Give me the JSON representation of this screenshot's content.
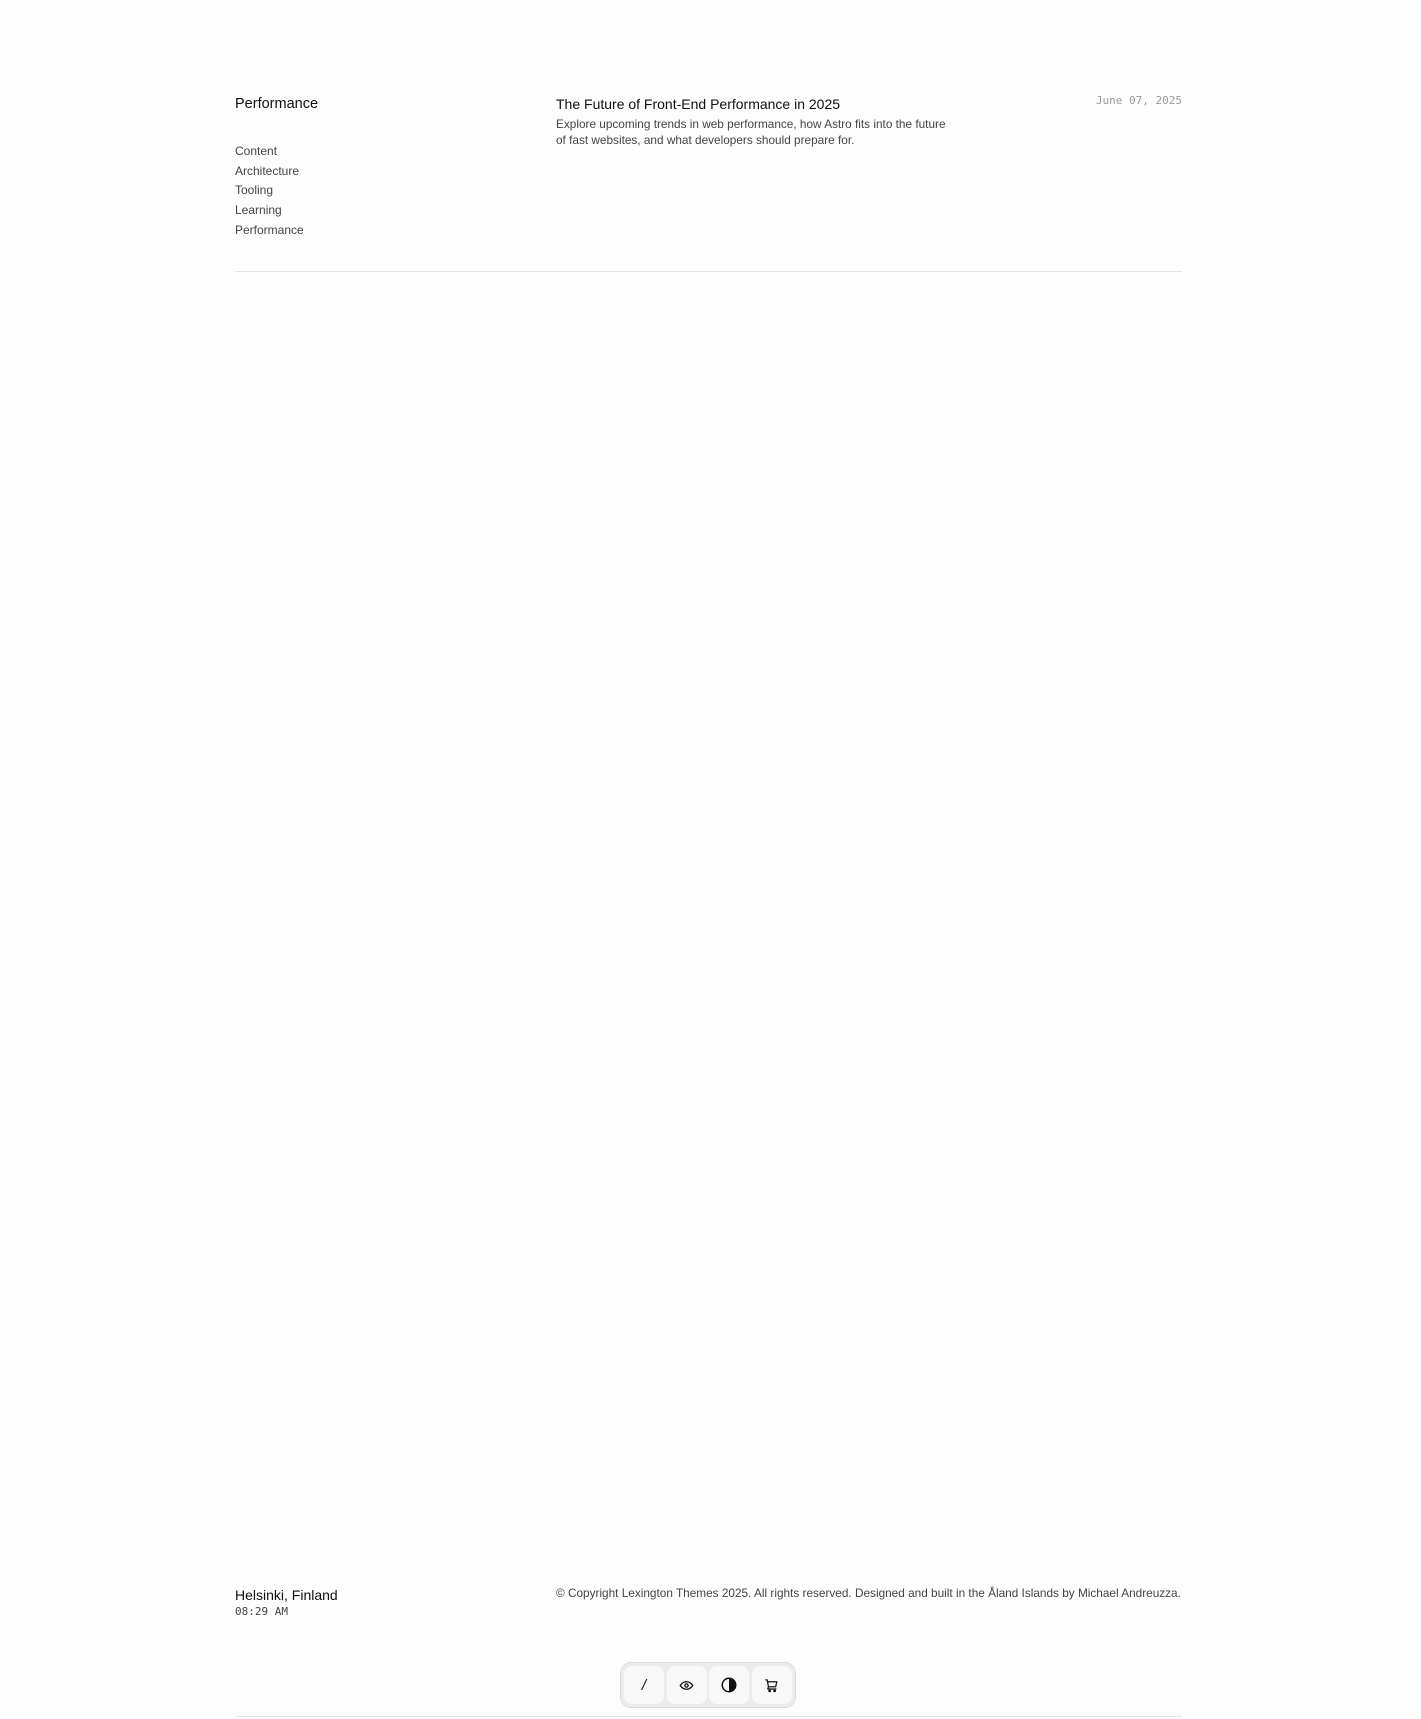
{
  "category": {
    "title": "Performance",
    "topics": [
      "Content",
      "Architecture",
      "Tooling",
      "Learning",
      "Performance"
    ]
  },
  "post": {
    "title": "The Future of Front-End Performance in 2025",
    "description": "Explore upcoming trends in web performance, how Astro fits into the future of fast websites, and what developers should prepare for.",
    "date": "June 07, 2025"
  },
  "footer": {
    "location": "Helsinki, Finland",
    "time": "08:29 AM",
    "copyright": "© Copyright Lexington Themes 2025. All rights reserved. Designed and built in the Åland Islands by Michael Andreuzza."
  },
  "toolbar": {
    "home_glyph": "/",
    "buttons": [
      "home-slash-icon",
      "eye-icon",
      "contrast-icon",
      "cart-icon"
    ]
  }
}
